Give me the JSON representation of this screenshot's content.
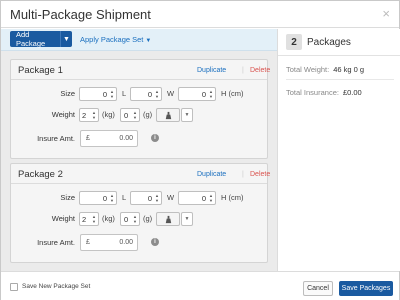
{
  "dialog": {
    "title": "Multi-Package Shipment",
    "close_glyph": "×"
  },
  "toolbar": {
    "add_package_label": "Add Package",
    "add_package_caret": "▼",
    "apply_set_label": "Apply Package Set",
    "apply_set_caret": "▼"
  },
  "packages": [
    {
      "title": "Package 1",
      "duplicate_label": "Duplicate",
      "delete_label": "Delete",
      "size_label": "Size",
      "length_value": "0",
      "l_label": "L",
      "width_value": "0",
      "w_label": "W",
      "height_value": "0",
      "h_label": "H (cm)",
      "weight_label": "Weight",
      "weight_kg_value": "2",
      "kg_label": "(kg)",
      "weight_g_value": "0",
      "g_label": "(g)",
      "insure_label": "Insure Amt.",
      "currency_symbol": "£",
      "insure_value": "0.00"
    },
    {
      "title": "Package 2",
      "duplicate_label": "Duplicate",
      "delete_label": "Delete",
      "size_label": "Size",
      "length_value": "0",
      "l_label": "L",
      "width_value": "0",
      "w_label": "W",
      "height_value": "0",
      "h_label": "H (cm)",
      "weight_label": "Weight",
      "weight_kg_value": "2",
      "kg_label": "(kg)",
      "weight_g_value": "0",
      "g_label": "(g)",
      "insure_label": "Insure Amt.",
      "currency_symbol": "£",
      "insure_value": "0.00"
    }
  ],
  "summary": {
    "count": "2",
    "count_label": "Packages",
    "total_weight_label": "Total Weight:",
    "total_weight_value": "46 kg  0 g",
    "total_insurance_label": "Total Insurance:",
    "total_insurance_value": "£0.00"
  },
  "footer": {
    "save_set_label": "Save New Package Set",
    "cancel_label": "Cancel",
    "save_label": "Save Packages"
  },
  "colors": {
    "primary": "#1a5aa0",
    "link": "#1a6fbf",
    "delete": "#d9534f",
    "toolbar_bg": "#e3f0f8",
    "pane_bg": "#ebebeb"
  }
}
